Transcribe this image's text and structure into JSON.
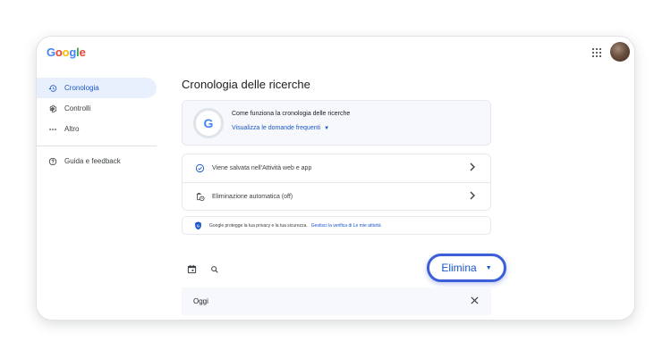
{
  "header": {
    "logo_letters": [
      {
        "ch": "G",
        "color": "#4285f4"
      },
      {
        "ch": "o",
        "color": "#ea4335"
      },
      {
        "ch": "o",
        "color": "#fbbc05"
      },
      {
        "ch": "g",
        "color": "#4285f4"
      },
      {
        "ch": "l",
        "color": "#34a853"
      },
      {
        "ch": "e",
        "color": "#ea4335"
      }
    ],
    "apps_icon": "apps-grid-icon",
    "avatar": "user-avatar"
  },
  "sidebar": {
    "items": [
      {
        "label": "Cronologia",
        "icon": "history-icon",
        "active": true
      },
      {
        "label": "Controlli",
        "icon": "settings-gear-icon",
        "active": false
      },
      {
        "label": "Altro",
        "icon": "more-dots-icon",
        "active": false
      }
    ],
    "help": {
      "label": "Guida e feedback",
      "icon": "help-circle-icon"
    }
  },
  "main": {
    "title": "Cronologia delle ricerche",
    "how": {
      "title": "Come funziona la cronologia delle ricerche",
      "link": "Visualizza le domande frequenti",
      "badge_letter": "G"
    },
    "rows": [
      {
        "label": "Viene salvata nell'Attività web e app",
        "icon": "check-circle-icon"
      },
      {
        "label": "Eliminazione automatica (off)",
        "icon": "auto-delete-icon"
      }
    ],
    "privacy": {
      "text": "Google protegge la tua privacy e la tua sicurezza.",
      "link": "Gestisci la verifica di Le mie attività"
    },
    "delete_button": "Elimina",
    "today_label": "Oggi"
  },
  "colors": {
    "accent": "#1a56c9",
    "highlight_border": "#3c5ed6",
    "active_bg": "#e8f0fe"
  }
}
